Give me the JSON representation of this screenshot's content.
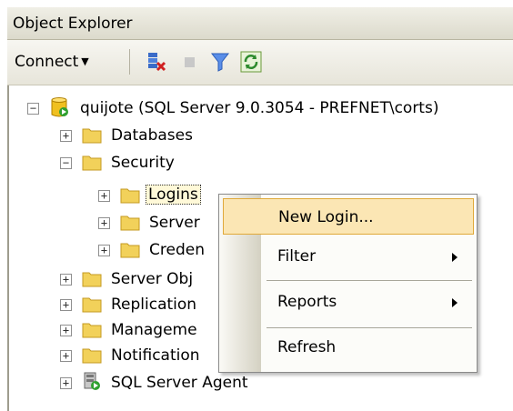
{
  "panel": {
    "title": "Object Explorer"
  },
  "toolbar": {
    "connect_label": "Connect",
    "icons": [
      "disconnect-icon",
      "stop-icon",
      "filter-icon",
      "refresh-icon"
    ]
  },
  "tree": {
    "root": "quijote (SQL Server 9.0.3054 - PREFNET\\corts)",
    "databases": "Databases",
    "security": "Security",
    "logins": "Logins",
    "server_roles": "Server",
    "credentials": "Creden",
    "server_objects": "Server Obj",
    "replication": "Replication",
    "management": "Manageme",
    "notification": "Notification",
    "sql_agent": "SQL Server Agent"
  },
  "context_menu": {
    "new_login": "New Login...",
    "filter": "Filter",
    "reports": "Reports",
    "refresh": "Refresh"
  },
  "colors": {
    "folder": "#f2d15a",
    "menu_highlight": "#fbe6b4",
    "menu_highlight_border": "#e0a93a"
  }
}
